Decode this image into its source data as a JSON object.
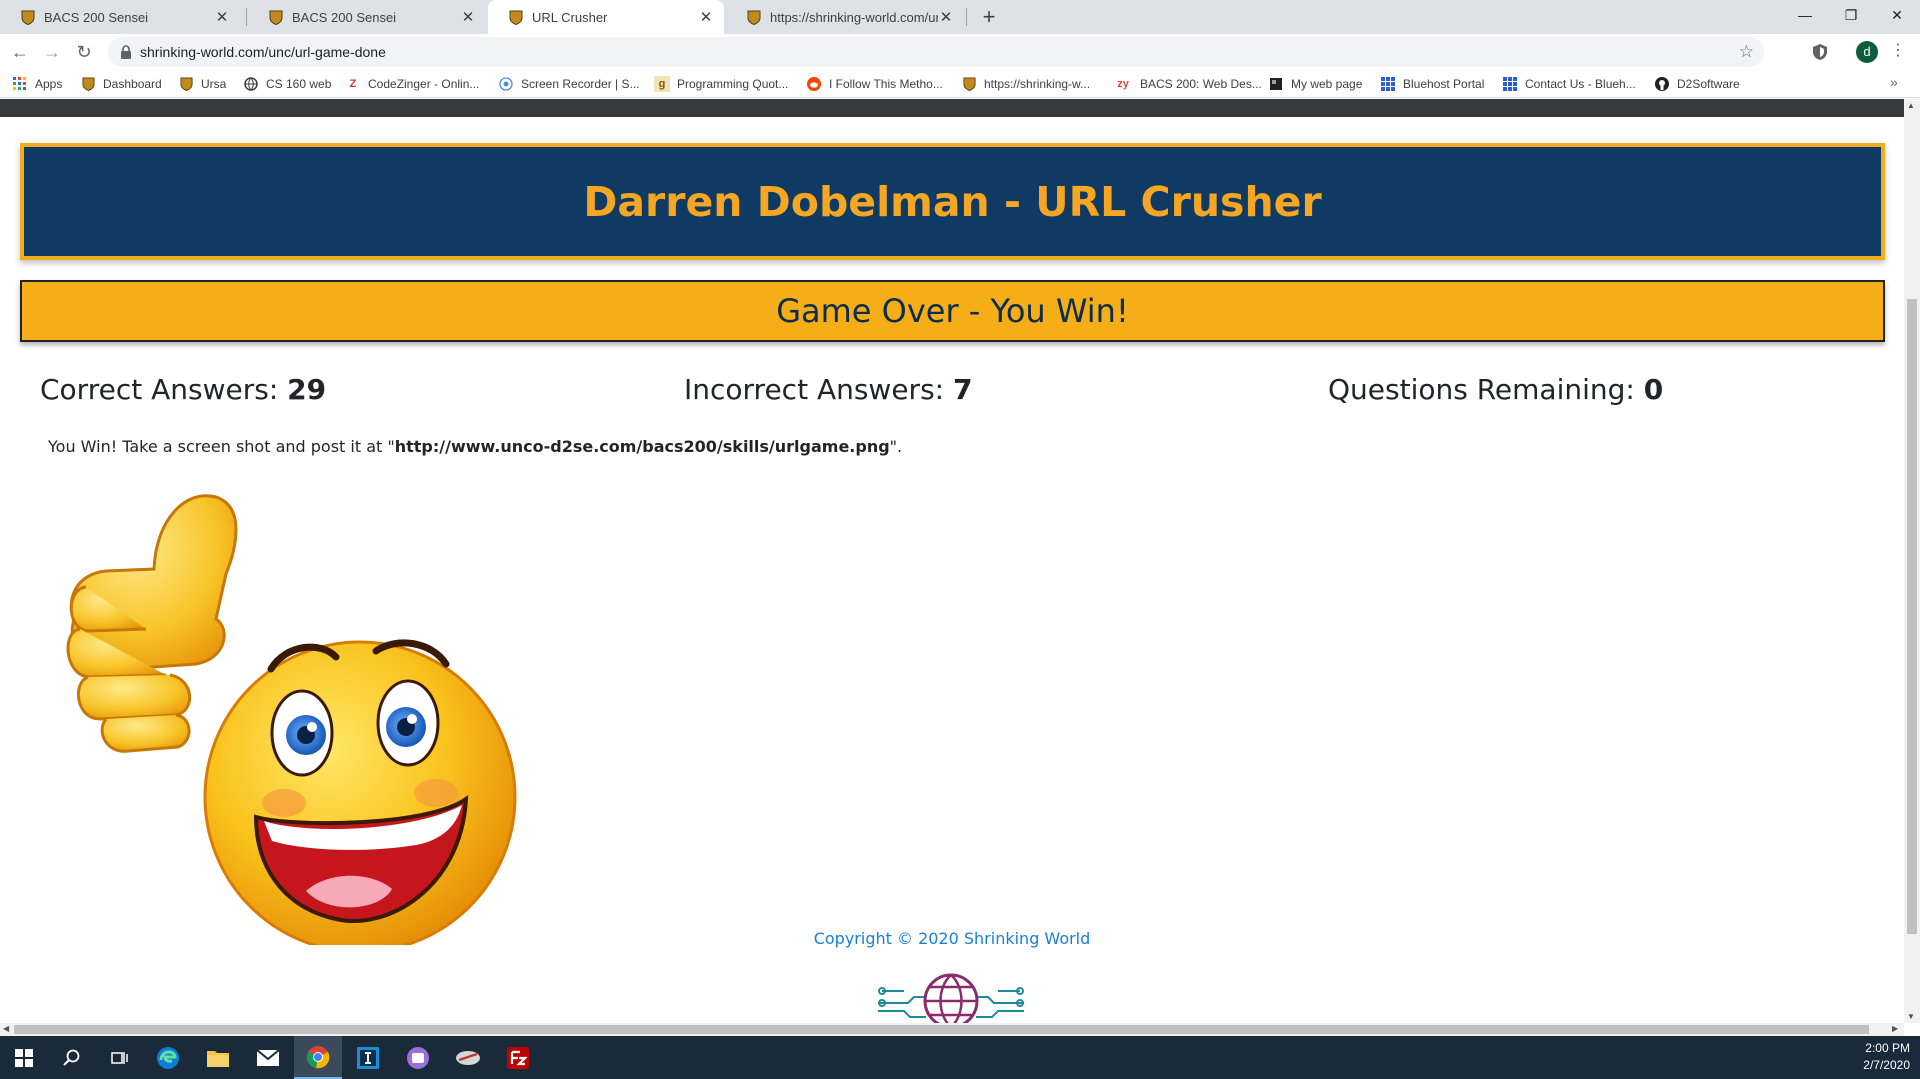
{
  "browser": {
    "tabs": [
      {
        "title": "BACS 200 Sensei",
        "active": false
      },
      {
        "title": "BACS 200 Sensei",
        "active": false
      },
      {
        "title": "URL Crusher",
        "active": true
      },
      {
        "title": "https://shrinking-world.com/unc",
        "active": false
      }
    ],
    "url": "shrinking-world.com/unc/url-game-done",
    "profile_initial": "d",
    "bookmarks": [
      {
        "label": "Apps",
        "icon": "apps-grid-icon"
      },
      {
        "label": "Dashboard",
        "icon": "bear-shield-icon"
      },
      {
        "label": "Ursa",
        "icon": "bear-shield-icon"
      },
      {
        "label": "CS 160 web",
        "icon": "globe-icon"
      },
      {
        "label": "CodeZinger - Onlin...",
        "icon": "codezinger-icon"
      },
      {
        "label": "Screen Recorder | S...",
        "icon": "record-icon"
      },
      {
        "label": "Programming Quot...",
        "icon": "g-icon"
      },
      {
        "label": "I Follow This Metho...",
        "icon": "reddit-icon"
      },
      {
        "label": "https://shrinking-w...",
        "icon": "bear-shield-icon"
      },
      {
        "label": "BACS 200: Web Des...",
        "icon": "zy-icon"
      },
      {
        "label": "My web page",
        "icon": "page-icon"
      },
      {
        "label": "Bluehost Portal",
        "icon": "bluehost-icon"
      },
      {
        "label": "Contact Us - Blueh...",
        "icon": "bluehost-icon"
      },
      {
        "label": "D2Software",
        "icon": "github-icon"
      }
    ]
  },
  "page": {
    "header_title": "Darren Dobelman - URL Crusher",
    "result_title": "Game Over - You Win!",
    "stats": {
      "correct_label": "Correct Answers:",
      "correct_value": "29",
      "incorrect_label": "Incorrect Answers:",
      "incorrect_value": "7",
      "remaining_label": "Questions Remaining:",
      "remaining_value": "0"
    },
    "message_prefix": "You Win! Take a screen shot and post it at \"",
    "message_link": "http://www.unco-d2se.com/bacs200/skills/urlgame.png",
    "message_suffix": "\".",
    "copyright": "Copyright © 2020 Shrinking World"
  },
  "taskbar": {
    "time": "2:00 PM",
    "date": "2/7/2020"
  },
  "colors": {
    "header_bg": "#0e3a64",
    "header_text": "#f5a623",
    "banner_bg": "#f5ae17",
    "banner_text": "#0e2d4a",
    "link_blue": "#1a7fd6"
  }
}
